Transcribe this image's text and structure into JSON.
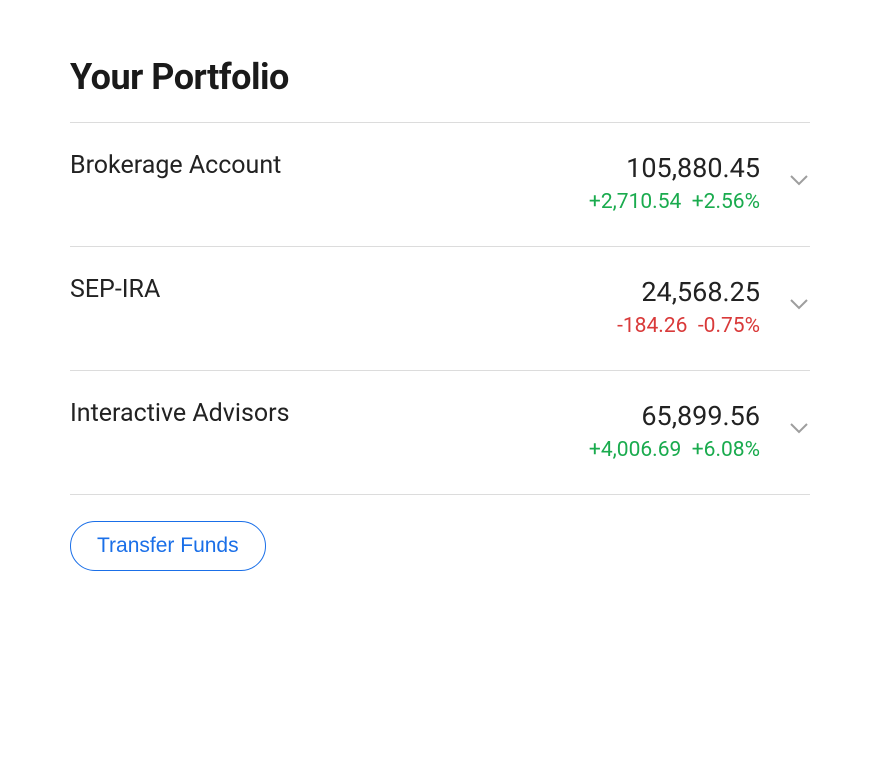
{
  "title": "Your Portfolio",
  "accounts": [
    {
      "name": "Brokerage Account",
      "balance": "105,880.45",
      "change_abs": "+2,710.54",
      "change_pct": "+2.56%",
      "direction": "positive"
    },
    {
      "name": "SEP-IRA",
      "balance": "24,568.25",
      "change_abs": "-184.26",
      "change_pct": "-0.75%",
      "direction": "negative"
    },
    {
      "name": "Interactive Advisors",
      "balance": "65,899.56",
      "change_abs": "+4,006.69",
      "change_pct": "+6.08%",
      "direction": "positive"
    }
  ],
  "transfer_label": "Transfer Funds"
}
